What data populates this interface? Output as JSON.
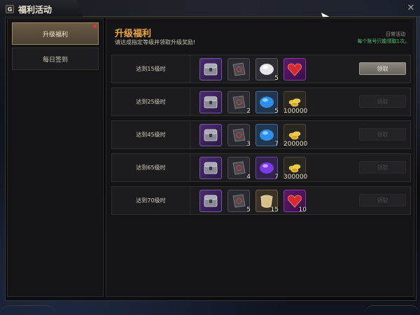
{
  "window": {
    "title": "福利活动",
    "logo_letter": "G",
    "close_glyph": "✕"
  },
  "sidebar": {
    "items": [
      {
        "label": "升级福利",
        "active": true,
        "badge": true
      },
      {
        "label": "每日签到",
        "active": false,
        "badge": false
      }
    ]
  },
  "main": {
    "title": "升级福利",
    "subtitle": "请达成指定等级并领取升级奖励!",
    "daily_label": "日常活动",
    "daily_note": "每个账号只能领取1次。"
  },
  "rows": [
    {
      "label": "达到15级时",
      "button": "领取",
      "claimable": true,
      "rewards": [
        {
          "icon": "chest-icon",
          "qty": ""
        },
        {
          "icon": "book-icon",
          "qty": ""
        },
        {
          "icon": "white-orb-icon",
          "qty": "5"
        },
        {
          "icon": "red-heart-gem-icon",
          "qty": ""
        }
      ]
    },
    {
      "label": "达到25级时",
      "button": "领取",
      "claimable": false,
      "rewards": [
        {
          "icon": "chest-icon",
          "qty": ""
        },
        {
          "icon": "book-icon",
          "qty": "2"
        },
        {
          "icon": "blue-orb-icon",
          "qty": "5"
        },
        {
          "icon": "gold-coin-icon",
          "qty": "100000"
        }
      ]
    },
    {
      "label": "达到45级时",
      "button": "领取",
      "claimable": false,
      "rewards": [
        {
          "icon": "chest-icon",
          "qty": ""
        },
        {
          "icon": "book-icon",
          "qty": "3"
        },
        {
          "icon": "blue-orb-icon",
          "qty": "7"
        },
        {
          "icon": "gold-coin-icon",
          "qty": "200000"
        }
      ]
    },
    {
      "label": "达到65级时",
      "button": "领取",
      "claimable": false,
      "rewards": [
        {
          "icon": "chest-icon",
          "qty": ""
        },
        {
          "icon": "book-icon",
          "qty": "4"
        },
        {
          "icon": "purple-orb-icon",
          "qty": "7"
        },
        {
          "icon": "gold-coin-icon",
          "qty": "300000"
        }
      ]
    },
    {
      "label": "达到70级时",
      "button": "领取",
      "claimable": false,
      "rewards": [
        {
          "icon": "chest-icon",
          "qty": ""
        },
        {
          "icon": "book-icon",
          "qty": "5"
        },
        {
          "icon": "scroll-icon",
          "qty": "15"
        },
        {
          "icon": "red-heart-gem-icon",
          "qty": "10"
        }
      ]
    }
  ],
  "colors": {
    "title_accent": "#f0a73c",
    "note_green": "#48c86a",
    "active_tab": "#6a5a46"
  }
}
